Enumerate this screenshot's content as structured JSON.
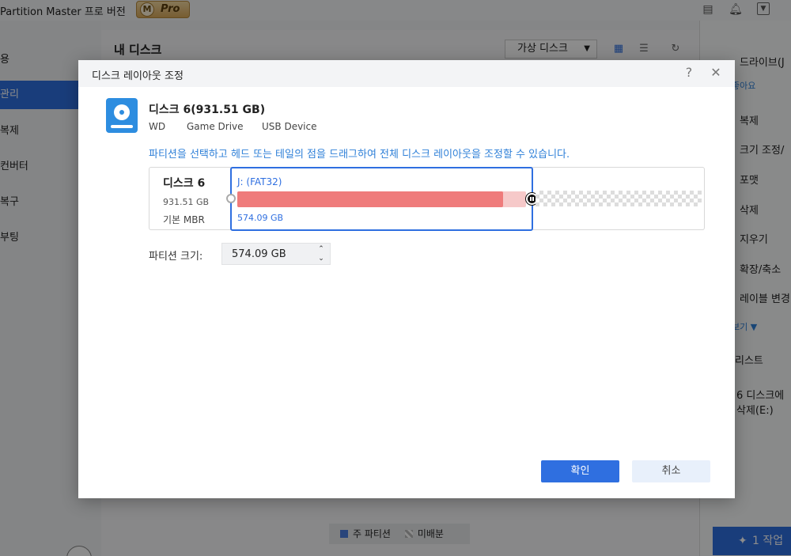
{
  "app": {
    "title": "Partition Master 프로 버전",
    "badge_letter": "M",
    "badge_text": "Pro"
  },
  "sidebar": {
    "items": [
      {
        "label": "용",
        "active": false
      },
      {
        "label": "관리",
        "active": true
      },
      {
        "label": "복제",
        "active": false
      },
      {
        "label": "컨버터",
        "active": false
      },
      {
        "label": "복구",
        "active": false
      },
      {
        "label": "부팅",
        "active": false
      }
    ]
  },
  "main": {
    "title": "내 디스크",
    "virtual_disk_button": "가상 디스크",
    "legend": {
      "primary": "주 파티션",
      "unallocated": "미배분"
    }
  },
  "right_panel": {
    "items": [
      "드라이브(J",
      "좋아요",
      "복제",
      "크기 조정/",
      "포맷",
      "삭제",
      "지우기",
      "확장/축소",
      "레이블 변경",
      "보기 ▼",
      "리스트",
      "6 디스크에",
      "삭제(E:)"
    ],
    "apply_label": "1 작업"
  },
  "dialog": {
    "title": "디스크 레이아웃 조정",
    "disk": {
      "name": "디스크 6(931.51 GB)",
      "vendor": "WD",
      "model": "Game Drive",
      "interface": "USB Device"
    },
    "instruction": "파티션을 선택하고 헤드 또는 테일의 점을 드래그하여 전체 디스크 레이아웃을 조정할 수 있습니다.",
    "layout": {
      "disk_label": "디스크 6",
      "disk_size": "931.51 GB",
      "disk_type": "기본 MBR",
      "partition_label": "J: (FAT32)",
      "partition_size": "574.09 GB",
      "used_fraction": 0.92
    },
    "partition_size_label": "파티션 크기:",
    "partition_size_value": "574.09 GB",
    "ok_label": "확인",
    "cancel_label": "취소"
  },
  "colors": {
    "accent": "#2f6fe0",
    "partition_used": "#ef7b7b",
    "partition_track": "#f6c9c9",
    "instruction": "#2f80d8"
  }
}
